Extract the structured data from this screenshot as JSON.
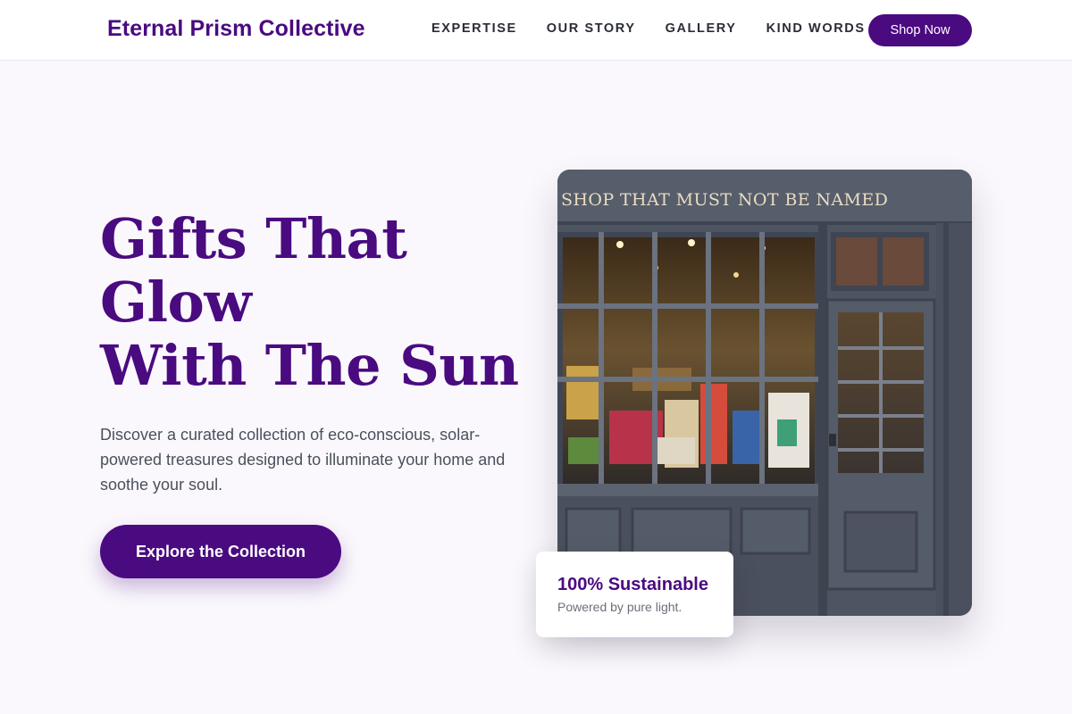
{
  "header": {
    "brand": "Eternal Prism Collective",
    "nav": [
      "EXPERTISE",
      "OUR STORY",
      "GALLERY",
      "KIND WORDS"
    ],
    "cta_label": "Shop Now"
  },
  "hero": {
    "title_lines": [
      "Gifts That",
      "Glow",
      "With The Sun"
    ],
    "description": "Discover a curated collection of eco-conscious, solar-powered treasures designed to illuminate your home and soothe your soul.",
    "cta_label": "Explore the Collection"
  },
  "image": {
    "sign_text": "SHOP THAT MUST NOT BE NAMED"
  },
  "badge": {
    "title": "100% Sustainable",
    "subtitle": "Powered by pure light."
  },
  "colors": {
    "brand": "#4a0a80",
    "background": "#faf8fc",
    "storefront": "#4d5462"
  }
}
